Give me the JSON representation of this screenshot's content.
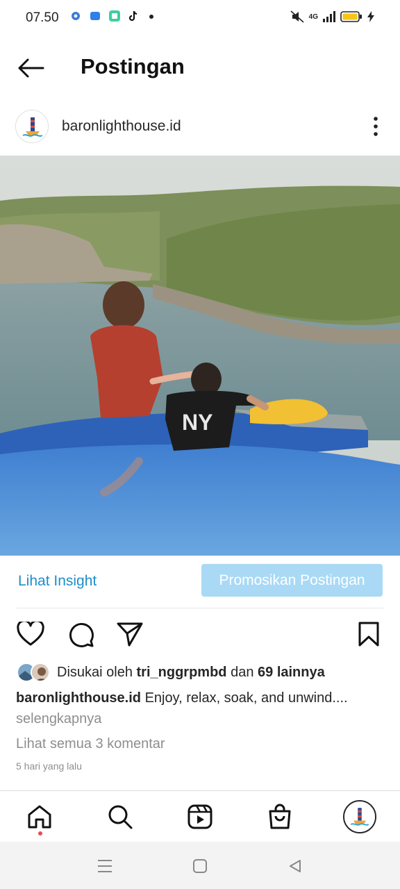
{
  "status_bar": {
    "time": "07.50",
    "network": "4G",
    "icons_left": [
      "settings-icon",
      "app-icon",
      "app-icon",
      "tiktok-icon",
      "dot-icon"
    ],
    "icons_right": [
      "mute-icon",
      "signal-icon",
      "battery-icon",
      "charging-icon"
    ],
    "battery_color": "#f5c518"
  },
  "header": {
    "title": "Postingan"
  },
  "post": {
    "username": "baronlighthouse.id",
    "insight_label": "Lihat Insight",
    "promote_label": "Promosikan Postingan",
    "likes_prefix": "Disukai oleh",
    "likes_user": "tri_nggrpmbd",
    "likes_middle": "dan",
    "likes_others": "69 lainnya",
    "caption_user": "baronlighthouse.id",
    "caption_text": "Enjoy, relax, soak, and unwind....",
    "more_label": "selengkapnya",
    "comments_label": "Lihat semua 3 komentar",
    "timestamp": "5 hari yang lalu"
  },
  "colors": {
    "link": "#1c8ecb",
    "promote_bg": "#a9d9f5",
    "muted": "#8e8e8e",
    "notification_dot": "#ed4956"
  },
  "bottom_nav": [
    "home-icon",
    "search-icon",
    "reels-icon",
    "shop-icon",
    "profile-avatar"
  ],
  "system_nav": [
    "menu-icon",
    "home-square-icon",
    "back-triangle-icon"
  ]
}
